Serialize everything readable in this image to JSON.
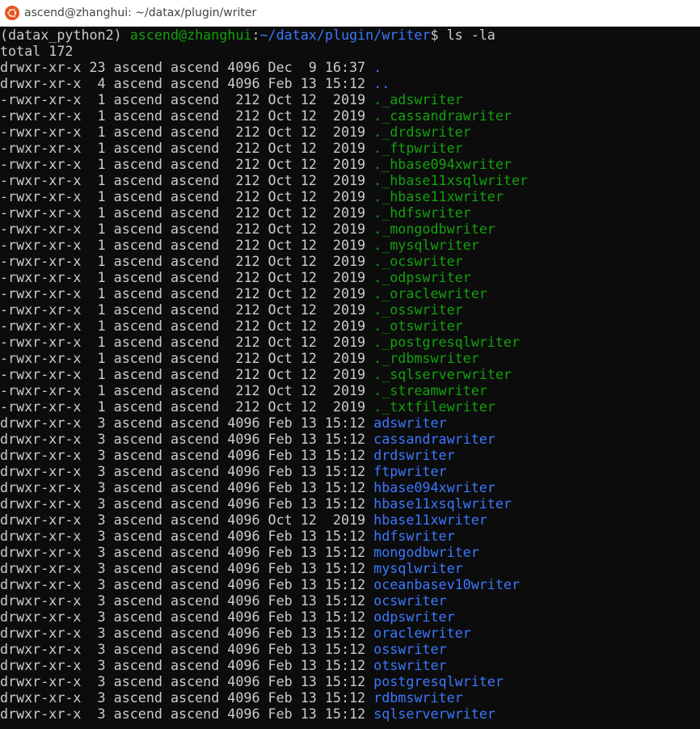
{
  "window": {
    "title": "ascend@zhanghui: ~/datax/plugin/writer",
    "icon": "ubuntu-icon"
  },
  "colors": {
    "background": "#0c0c0c",
    "text": "#cccccc",
    "user_host": "#13a10e",
    "path": "#3b78ff",
    "file": "#13a10e",
    "directory": "#3b78ff"
  },
  "prompt": {
    "env": "(datax_python2) ",
    "user_host": "ascend@zhanghui",
    "colon": ":",
    "path": "~/datax/plugin/writer",
    "suffix": "$ ",
    "command": "ls -la"
  },
  "total": "total 172",
  "listing": [
    {
      "meta": "drwxr-xr-x 23 ascend ascend 4096 Dec  9 16:37 ",
      "name": ".",
      "type": "dir"
    },
    {
      "meta": "drwxr-xr-x  4 ascend ascend 4096 Feb 13 15:12 ",
      "name": "..",
      "type": "dir"
    },
    {
      "meta": "-rwxr-xr-x  1 ascend ascend  212 Oct 12  2019 ",
      "name": "._adswriter",
      "type": "file"
    },
    {
      "meta": "-rwxr-xr-x  1 ascend ascend  212 Oct 12  2019 ",
      "name": "._cassandrawriter",
      "type": "file"
    },
    {
      "meta": "-rwxr-xr-x  1 ascend ascend  212 Oct 12  2019 ",
      "name": "._drdswriter",
      "type": "file"
    },
    {
      "meta": "-rwxr-xr-x  1 ascend ascend  212 Oct 12  2019 ",
      "name": "._ftpwriter",
      "type": "file"
    },
    {
      "meta": "-rwxr-xr-x  1 ascend ascend  212 Oct 12  2019 ",
      "name": "._hbase094xwriter",
      "type": "file"
    },
    {
      "meta": "-rwxr-xr-x  1 ascend ascend  212 Oct 12  2019 ",
      "name": "._hbase11xsqlwriter",
      "type": "file"
    },
    {
      "meta": "-rwxr-xr-x  1 ascend ascend  212 Oct 12  2019 ",
      "name": "._hbase11xwriter",
      "type": "file"
    },
    {
      "meta": "-rwxr-xr-x  1 ascend ascend  212 Oct 12  2019 ",
      "name": "._hdfswriter",
      "type": "file"
    },
    {
      "meta": "-rwxr-xr-x  1 ascend ascend  212 Oct 12  2019 ",
      "name": "._mongodbwriter",
      "type": "file"
    },
    {
      "meta": "-rwxr-xr-x  1 ascend ascend  212 Oct 12  2019 ",
      "name": "._mysqlwriter",
      "type": "file"
    },
    {
      "meta": "-rwxr-xr-x  1 ascend ascend  212 Oct 12  2019 ",
      "name": "._ocswriter",
      "type": "file"
    },
    {
      "meta": "-rwxr-xr-x  1 ascend ascend  212 Oct 12  2019 ",
      "name": "._odpswriter",
      "type": "file"
    },
    {
      "meta": "-rwxr-xr-x  1 ascend ascend  212 Oct 12  2019 ",
      "name": "._oraclewriter",
      "type": "file"
    },
    {
      "meta": "-rwxr-xr-x  1 ascend ascend  212 Oct 12  2019 ",
      "name": "._osswriter",
      "type": "file"
    },
    {
      "meta": "-rwxr-xr-x  1 ascend ascend  212 Oct 12  2019 ",
      "name": "._otswriter",
      "type": "file"
    },
    {
      "meta": "-rwxr-xr-x  1 ascend ascend  212 Oct 12  2019 ",
      "name": "._postgresqlwriter",
      "type": "file"
    },
    {
      "meta": "-rwxr-xr-x  1 ascend ascend  212 Oct 12  2019 ",
      "name": "._rdbmswriter",
      "type": "file"
    },
    {
      "meta": "-rwxr-xr-x  1 ascend ascend  212 Oct 12  2019 ",
      "name": "._sqlserverwriter",
      "type": "file"
    },
    {
      "meta": "-rwxr-xr-x  1 ascend ascend  212 Oct 12  2019 ",
      "name": "._streamwriter",
      "type": "file"
    },
    {
      "meta": "-rwxr-xr-x  1 ascend ascend  212 Oct 12  2019 ",
      "name": "._txtfilewriter",
      "type": "file"
    },
    {
      "meta": "drwxr-xr-x  3 ascend ascend 4096 Feb 13 15:12 ",
      "name": "adswriter",
      "type": "dir"
    },
    {
      "meta": "drwxr-xr-x  3 ascend ascend 4096 Feb 13 15:12 ",
      "name": "cassandrawriter",
      "type": "dir"
    },
    {
      "meta": "drwxr-xr-x  3 ascend ascend 4096 Feb 13 15:12 ",
      "name": "drdswriter",
      "type": "dir"
    },
    {
      "meta": "drwxr-xr-x  3 ascend ascend 4096 Feb 13 15:12 ",
      "name": "ftpwriter",
      "type": "dir"
    },
    {
      "meta": "drwxr-xr-x  3 ascend ascend 4096 Feb 13 15:12 ",
      "name": "hbase094xwriter",
      "type": "dir"
    },
    {
      "meta": "drwxr-xr-x  3 ascend ascend 4096 Feb 13 15:12 ",
      "name": "hbase11xsqlwriter",
      "type": "dir"
    },
    {
      "meta": "drwxr-xr-x  3 ascend ascend 4096 Oct 12  2019 ",
      "name": "hbase11xwriter",
      "type": "dir"
    },
    {
      "meta": "drwxr-xr-x  3 ascend ascend 4096 Feb 13 15:12 ",
      "name": "hdfswriter",
      "type": "dir"
    },
    {
      "meta": "drwxr-xr-x  3 ascend ascend 4096 Feb 13 15:12 ",
      "name": "mongodbwriter",
      "type": "dir"
    },
    {
      "meta": "drwxr-xr-x  3 ascend ascend 4096 Feb 13 15:12 ",
      "name": "mysqlwriter",
      "type": "dir"
    },
    {
      "meta": "drwxr-xr-x  3 ascend ascend 4096 Feb 13 15:12 ",
      "name": "oceanbasev10writer",
      "type": "dir"
    },
    {
      "meta": "drwxr-xr-x  3 ascend ascend 4096 Feb 13 15:12 ",
      "name": "ocswriter",
      "type": "dir"
    },
    {
      "meta": "drwxr-xr-x  3 ascend ascend 4096 Feb 13 15:12 ",
      "name": "odpswriter",
      "type": "dir"
    },
    {
      "meta": "drwxr-xr-x  3 ascend ascend 4096 Feb 13 15:12 ",
      "name": "oraclewriter",
      "type": "dir"
    },
    {
      "meta": "drwxr-xr-x  3 ascend ascend 4096 Feb 13 15:12 ",
      "name": "osswriter",
      "type": "dir"
    },
    {
      "meta": "drwxr-xr-x  3 ascend ascend 4096 Feb 13 15:12 ",
      "name": "otswriter",
      "type": "dir"
    },
    {
      "meta": "drwxr-xr-x  3 ascend ascend 4096 Feb 13 15:12 ",
      "name": "postgresqlwriter",
      "type": "dir"
    },
    {
      "meta": "drwxr-xr-x  3 ascend ascend 4096 Feb 13 15:12 ",
      "name": "rdbmswriter",
      "type": "dir"
    },
    {
      "meta": "drwxr-xr-x  3 ascend ascend 4096 Feb 13 15:12 ",
      "name": "sqlserverwriter",
      "type": "dir"
    }
  ]
}
